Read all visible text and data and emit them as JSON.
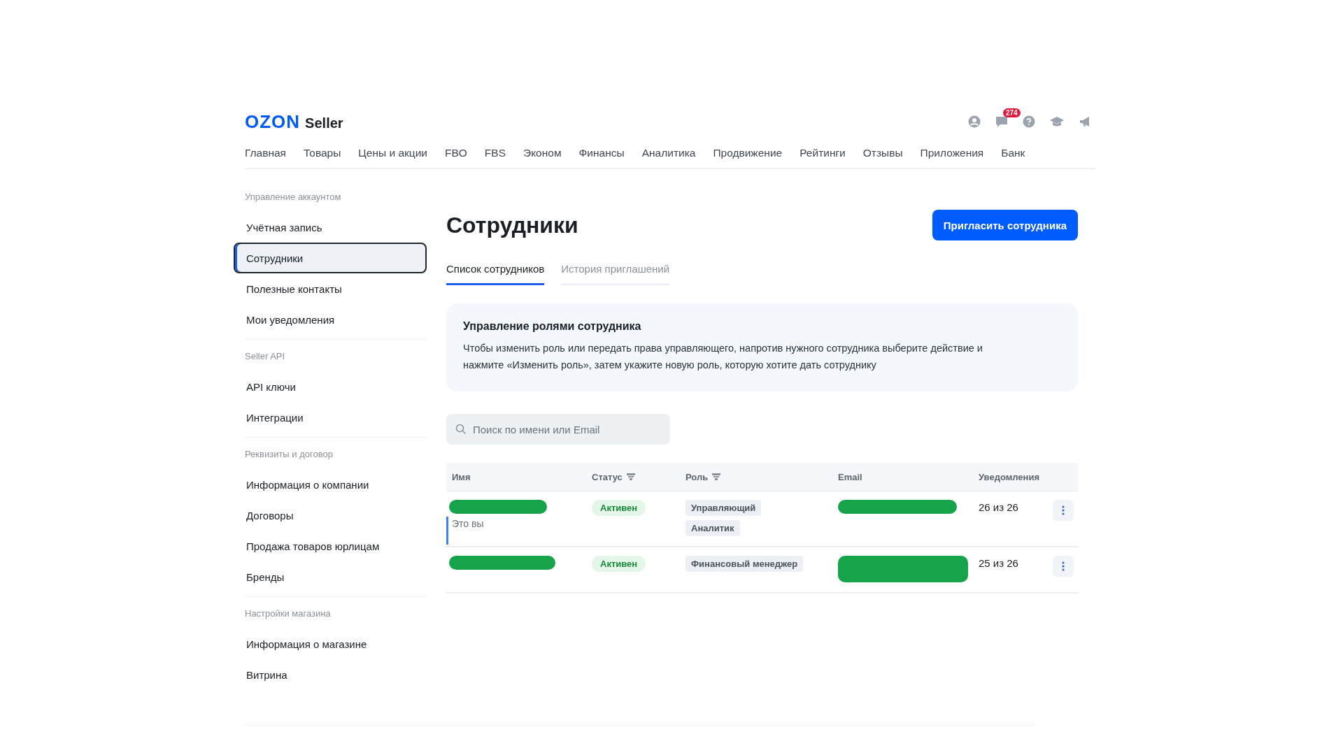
{
  "header": {
    "logo": "OZON",
    "logo_suffix": "Seller",
    "notifications_badge": "274"
  },
  "nav": [
    "Главная",
    "Товары",
    "Цены и акции",
    "FBO",
    "FBS",
    "Эконом",
    "Финансы",
    "Аналитика",
    "Продвижение",
    "Рейтинги",
    "Отзывы",
    "Приложения",
    "Банк"
  ],
  "sidebar": [
    {
      "heading": "Управление аккаунтом",
      "items": [
        {
          "label": "Учётная запись",
          "selected": false
        },
        {
          "label": "Сотрудники",
          "selected": true
        },
        {
          "label": "Полезные контакты",
          "selected": false
        },
        {
          "label": "Мои уведомления",
          "selected": false
        }
      ]
    },
    {
      "heading": "Seller API",
      "items": [
        {
          "label": "API ключи",
          "selected": false
        },
        {
          "label": "Интеграции",
          "selected": false
        }
      ]
    },
    {
      "heading": "Реквизиты и договор",
      "items": [
        {
          "label": "Информация о компании",
          "selected": false
        },
        {
          "label": "Договоры",
          "selected": false
        },
        {
          "label": "Продажа товаров юрлицам",
          "selected": false
        },
        {
          "label": "Бренды",
          "selected": false
        }
      ]
    },
    {
      "heading": "Настройки магазина",
      "items": [
        {
          "label": "Информация о магазине",
          "selected": false
        },
        {
          "label": "Витрина",
          "selected": false
        }
      ]
    }
  ],
  "page": {
    "title": "Сотрудники",
    "invite_button": "Пригласить сотрудника",
    "tabs": [
      {
        "label": "Список сотрудников",
        "selected": true
      },
      {
        "label": "История приглашений",
        "selected": false
      }
    ],
    "info": {
      "title": "Управление ролями сотрудника",
      "text": "Чтобы изменить роль или передать права управляющего, напротив нужного сотрудника выберите действие и нажмите «Изменить роль», затем укажите новую роль, которую хотите дать сотруднику"
    },
    "search": {
      "placeholder": "Поиск по имени или Email"
    },
    "table": {
      "columns": [
        {
          "label": "Имя",
          "filter": false
        },
        {
          "label": "Статус",
          "filter": true
        },
        {
          "label": "Роль",
          "filter": true
        },
        {
          "label": "Email",
          "filter": false
        },
        {
          "label": "Уведомления",
          "filter": false
        }
      ],
      "rows": [
        {
          "current": true,
          "note": "Это вы",
          "status": "Активен",
          "roles": [
            "Управляющий",
            "Аналитик"
          ],
          "notifications": "26 из 26"
        },
        {
          "current": false,
          "status": "Активен",
          "roles": [
            "Финансовый менеджер"
          ],
          "notifications": "25 из 26"
        }
      ]
    }
  }
}
